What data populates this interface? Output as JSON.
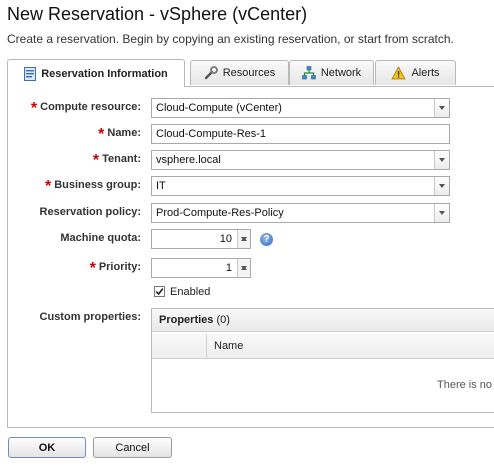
{
  "header": {
    "title": "New Reservation - vSphere (vCenter)",
    "subtitle": "Create a reservation. Begin by copying an existing reservation, or start from scratch."
  },
  "tabs": [
    {
      "label": "Reservation Information",
      "icon": "form-icon",
      "active": true
    },
    {
      "label": "Resources",
      "icon": "wrench-icon",
      "active": false
    },
    {
      "label": "Network",
      "icon": "network-icon",
      "active": false
    },
    {
      "label": "Alerts",
      "icon": "warning-icon",
      "active": false
    }
  ],
  "form": {
    "compute_resource": {
      "label": "Compute resource:",
      "value": "Cloud-Compute (vCenter)",
      "required": true
    },
    "name": {
      "label": "Name:",
      "value": "Cloud-Compute-Res-1",
      "required": true
    },
    "tenant": {
      "label": "Tenant:",
      "value": "vsphere.local",
      "required": true
    },
    "business_group": {
      "label": "Business group:",
      "value": "IT",
      "required": true
    },
    "reservation_policy": {
      "label": "Reservation policy:",
      "value": "Prod-Compute-Res-Policy",
      "required": false
    },
    "machine_quota": {
      "label": "Machine quota:",
      "value": "10",
      "required": false
    },
    "priority": {
      "label": "Priority:",
      "value": "1",
      "required": true
    },
    "enabled": {
      "label": "Enabled",
      "checked": true
    },
    "custom_properties": {
      "label": "Custom properties:"
    }
  },
  "properties": {
    "title": "Properties",
    "count": "(0)",
    "column_name": "Name",
    "empty_text": "There is no d"
  },
  "buttons": {
    "ok": "OK",
    "cancel": "Cancel"
  },
  "colors": {
    "required": "#cc0000",
    "help": "#2f6cc3"
  }
}
